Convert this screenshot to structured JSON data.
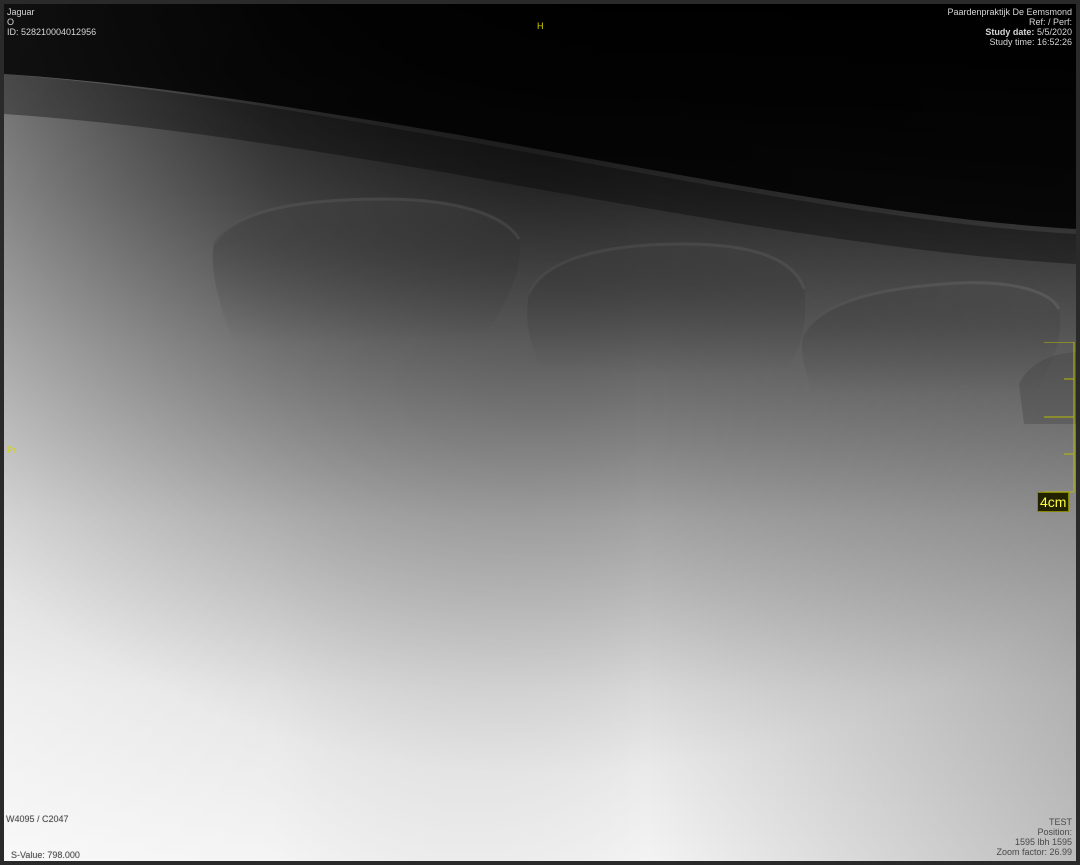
{
  "patient": {
    "name": "Jaguar",
    "sex": "O",
    "id": "ID: 528210004012956"
  },
  "study": {
    "practice": "Paardenpraktijk De Eemsmond",
    "ref_perf": "Ref: / Perf:",
    "date_label": "Study date:",
    "date": "5/5/2020",
    "time": "Study time: 16:52:26"
  },
  "orientation": {
    "top": "H",
    "left": "Pr"
  },
  "scale": {
    "label": "4cm"
  },
  "window": {
    "wl": "W4095 / C2047",
    "svalue": "S-Value: 798.000"
  },
  "image_info": {
    "test": "TEST",
    "position": "Position:",
    "dims": "1595 lbh 1595",
    "zoom": "Zoom factor: 26.99"
  },
  "colors": {
    "annotation": "#d6d6d6",
    "marker": "#d8d800",
    "scale": "#ffff40"
  }
}
